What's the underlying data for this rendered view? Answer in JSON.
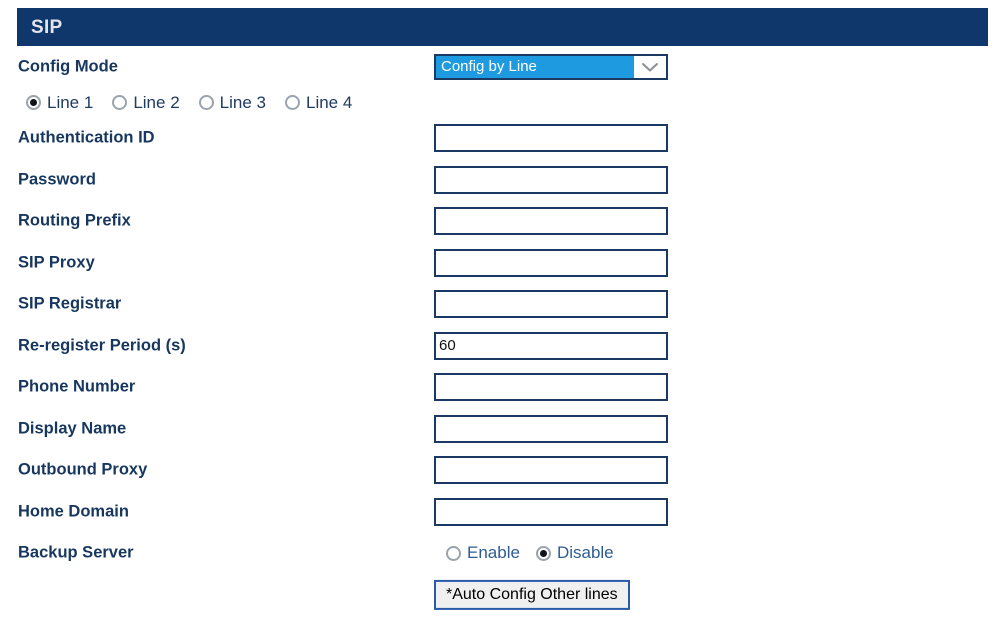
{
  "header": {
    "title": "SIP"
  },
  "config_mode": {
    "label": "Config Mode",
    "selected": "Config by Line",
    "options": [
      "Config by Line"
    ],
    "arrow_icon": "chevron-down-icon"
  },
  "line_selector": {
    "options": [
      {
        "label": "Line 1",
        "checked": true
      },
      {
        "label": "Line 2",
        "checked": false
      },
      {
        "label": "Line 3",
        "checked": false
      },
      {
        "label": "Line 4",
        "checked": false
      }
    ]
  },
  "fields": [
    {
      "label": "Authentication ID",
      "value": "",
      "placeholder": ""
    },
    {
      "label": "Password",
      "value": "",
      "placeholder": ""
    },
    {
      "label": "Routing Prefix",
      "value": "",
      "placeholder": ""
    },
    {
      "label": "SIP Proxy",
      "value": "",
      "placeholder": ""
    },
    {
      "label": "SIP Registrar",
      "value": "",
      "placeholder": ""
    },
    {
      "label": "Re-register Period (s)",
      "value": "60",
      "placeholder": ""
    },
    {
      "label": "Phone Number",
      "value": "",
      "placeholder": ""
    },
    {
      "label": "Display Name",
      "value": "",
      "placeholder": ""
    },
    {
      "label": "Outbound Proxy",
      "value": "",
      "placeholder": ""
    },
    {
      "label": "Home Domain",
      "value": "",
      "placeholder": ""
    }
  ],
  "backup_server": {
    "label": "Backup Server",
    "options": [
      {
        "label": "Enable",
        "checked": false
      },
      {
        "label": "Disable",
        "checked": true
      }
    ]
  },
  "auto_config_button": {
    "label": "*Auto Config Other lines"
  },
  "colors": {
    "header_bar": "#10376b",
    "header_text": "#e2e6ea",
    "label_text": "#17375e",
    "input_border": "#1b3a63",
    "select_highlight": "#1e9ae0",
    "button_border": "#2a5ba8",
    "button_face": "#f0f0f0",
    "radio_label": "#2d5c93"
  }
}
